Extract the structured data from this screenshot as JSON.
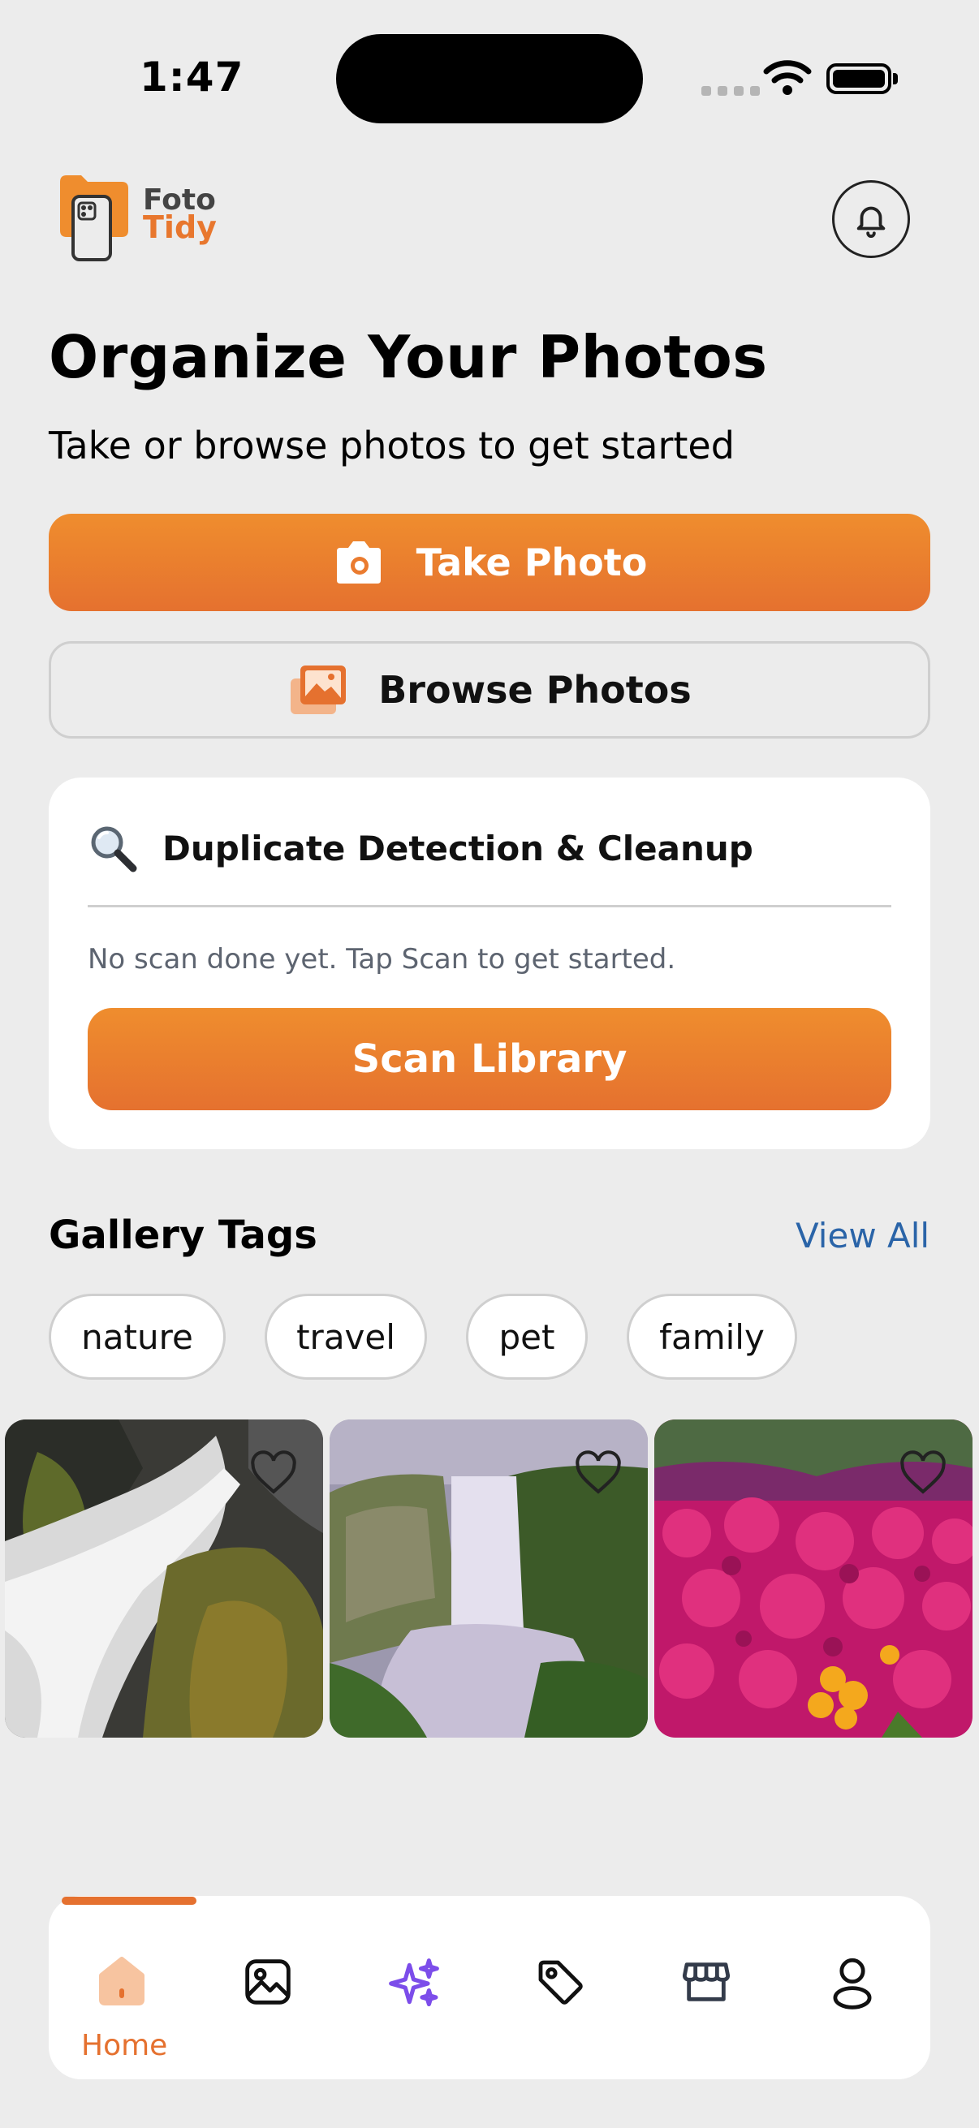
{
  "status_bar": {
    "time": "1:47"
  },
  "header": {
    "logo_line1": "Foto",
    "logo_line2": "Tidy"
  },
  "main": {
    "title": "Organize Your Photos",
    "subtitle": "Take or browse photos to get started",
    "take_photo_label": "Take Photo",
    "browse_photos_label": "Browse Photos"
  },
  "duplicate_card": {
    "title": "Duplicate Detection & Cleanup",
    "status": "No scan done yet. Tap Scan to get started.",
    "scan_label": "Scan Library"
  },
  "tags": {
    "title": "Gallery Tags",
    "view_all": "View All",
    "items": [
      "nature",
      "travel",
      "pet",
      "family"
    ]
  },
  "photos": [
    {
      "subject": "waterfall rocks with moss",
      "favorite": false
    },
    {
      "subject": "waterfall cliff in mist",
      "favorite": false
    },
    {
      "subject": "magenta flowers field",
      "favorite": false
    }
  ],
  "bottom_nav": {
    "active": "home",
    "items": [
      {
        "id": "home",
        "label": "Home",
        "icon": "home-icon"
      },
      {
        "id": "gallery",
        "icon": "image-icon"
      },
      {
        "id": "ai",
        "icon": "sparkles-icon"
      },
      {
        "id": "tags",
        "icon": "tag-icon"
      },
      {
        "id": "store",
        "icon": "store-icon"
      },
      {
        "id": "profile",
        "icon": "user-icon"
      }
    ]
  },
  "colors": {
    "accent": "#e5712f",
    "accent_light": "#ef8d2e",
    "link": "#2a64a8",
    "sparkle": "#7c4dea",
    "background": "#ececec"
  }
}
